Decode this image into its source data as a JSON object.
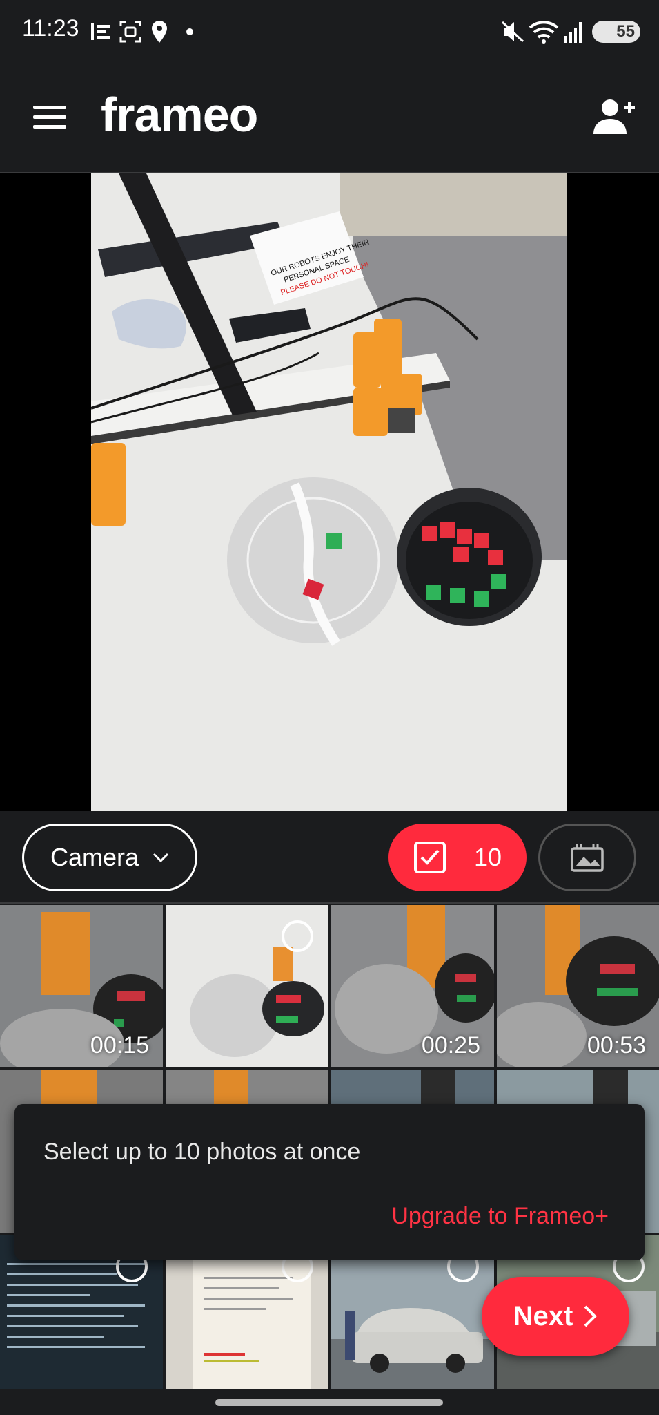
{
  "status_bar": {
    "time": "11:23",
    "battery": "55",
    "icons": [
      "notification-list-icon",
      "screenshot-icon",
      "location-icon",
      "dot-icon",
      "mute-icon",
      "wifi-icon",
      "signal-icon",
      "battery-icon"
    ]
  },
  "app_bar": {
    "logo": "frameo",
    "menu_icon": "hamburger-menu-icon",
    "add_friend_icon": "add-person-icon"
  },
  "toolbar": {
    "album_label": "Camera",
    "selected_count": "10",
    "accent_color": "#ff2a3d"
  },
  "grid": {
    "row1": [
      {
        "duration": "00:15",
        "type": "video"
      },
      {
        "duration": "",
        "type": "photo"
      },
      {
        "duration": "00:25",
        "type": "video"
      },
      {
        "duration": "00:53",
        "type": "video"
      }
    ]
  },
  "snackbar": {
    "message": "Select up to 10 photos at once",
    "action": "Upgrade to Frameo+"
  },
  "next_button": {
    "label": "Next"
  }
}
